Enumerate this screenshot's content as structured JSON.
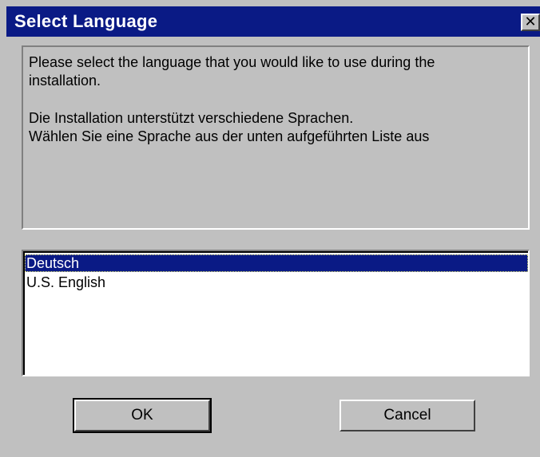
{
  "window": {
    "title": "Select Language",
    "close_glyph": "✕",
    "title_bar_color": "#0a1a85",
    "face_color": "#c0c0c0"
  },
  "message": {
    "line1": "Please select the language that you would like to use during the",
    "line2": "installation.",
    "line3": "Die Installation unterstützt verschiedene Sprachen.",
    "line4": "Wählen Sie eine Sprache aus der unten aufgeführten Liste aus"
  },
  "languages": {
    "items": [
      {
        "label": "Deutsch",
        "selected": true
      },
      {
        "label": "U.S. English",
        "selected": false
      }
    ],
    "selected_color": "#0a1a85"
  },
  "buttons": {
    "ok_label": "OK",
    "cancel_label": "Cancel"
  }
}
